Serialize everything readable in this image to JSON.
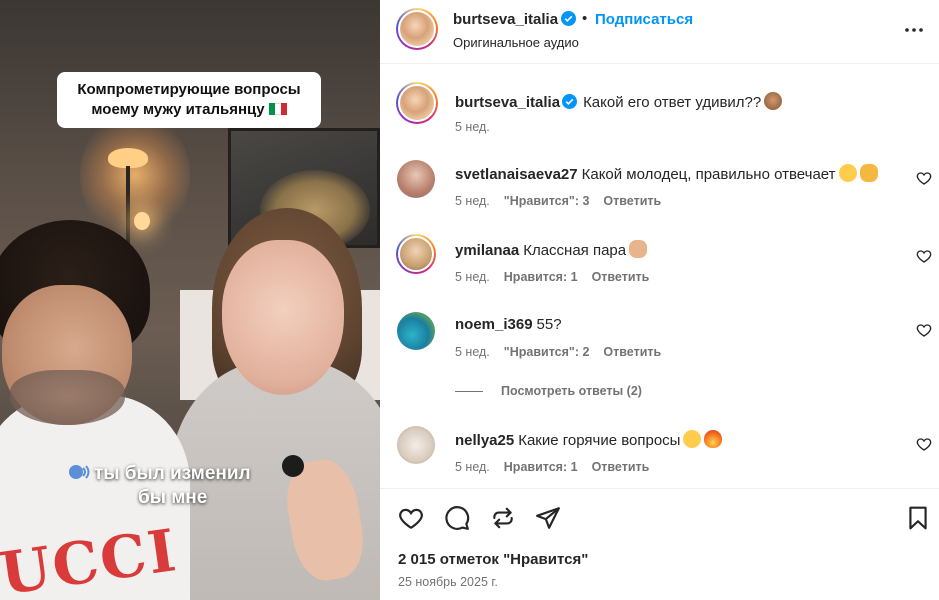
{
  "video": {
    "caption_line1": "Компрометирующие вопросы",
    "caption_line2": "моему мужу итальянцу",
    "subtitle_line1": "ты был изменил",
    "subtitle_line2": "бы мне",
    "shirt_text": "UCCI"
  },
  "header": {
    "username": "burtseva_italia",
    "separator": "•",
    "subscribe_label": "Подписаться",
    "audio_label": "Оригинальное аудио"
  },
  "caption": {
    "username": "burtseva_italia",
    "text": "Какой его ответ удивил??",
    "time": "5 нед."
  },
  "comments": [
    {
      "username": "svetlanaisaeva27",
      "text": "Какой молодец, правильно отвечает",
      "time": "5 нед.",
      "likes": "\"Нравится\": 3",
      "reply": "Ответить"
    },
    {
      "username": "ymilanaa",
      "text": "Классная пара",
      "time": "5 нед.",
      "likes": "Нравится: 1",
      "reply": "Ответить"
    },
    {
      "username": "noem_i369",
      "text": "55?",
      "time": "5 нед.",
      "likes": "\"Нравится\": 2",
      "reply": "Ответить"
    },
    {
      "username": "nellya25",
      "text": "Какие горячие вопросы",
      "time": "5 нед.",
      "likes": "Нравится: 1",
      "reply": "Ответить"
    }
  ],
  "view_replies_label": "Посмотреть ответы (2)",
  "footer": {
    "likes_count": "2 015 отметок \"Нравится\"",
    "date": "25 ноябрь 2025 г."
  },
  "colors": {
    "link_blue": "#0095f6",
    "verified_blue": "#0095f6",
    "text_primary": "#262626",
    "text_secondary": "#737373"
  },
  "icons": {
    "header_more": "more-horizontal-icon",
    "like": "heart-icon",
    "comment": "comment-icon",
    "share": "repost-icon",
    "send": "send-icon",
    "save": "bookmark-icon"
  }
}
